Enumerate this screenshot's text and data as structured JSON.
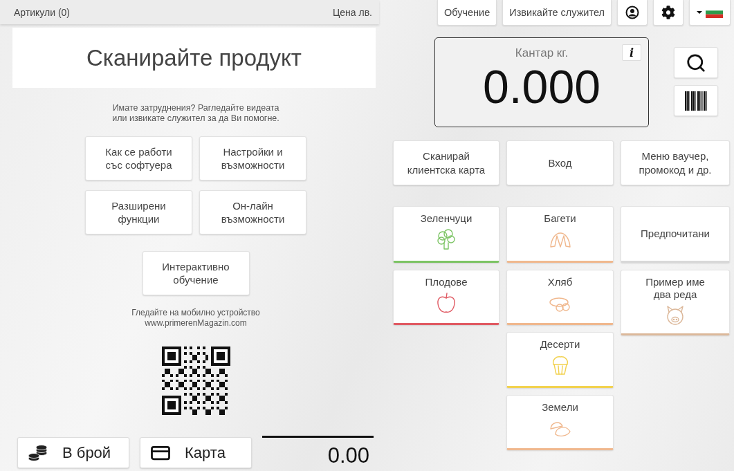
{
  "header": {
    "items_label": "Артикули (0)",
    "price_label": "Цена лв."
  },
  "top_buttons": [
    {
      "kind": "text",
      "label": "Обучение"
    },
    {
      "kind": "text",
      "label": "Извикайте служител"
    },
    {
      "kind": "user"
    },
    {
      "kind": "settings"
    },
    {
      "kind": "language"
    }
  ],
  "scan_prompt": "Сканирайте продукт",
  "help_text": "Имате затруднения? Рагледайте видеата\nили извикате служител за да Ви помогне.",
  "help_buttons": [
    {
      "label": "Как се работи\nсъс софтуера"
    },
    {
      "label": "Настройки и\nвъзможности"
    },
    {
      "label": "Разширени\nфункции"
    },
    {
      "label": "Он-лайн\nвъзможности"
    }
  ],
  "interactive_button": "Интерактивно\nобучение",
  "mobile_text": "Гледайте на мобилно устройство\nwww.primerenMagazin.com",
  "payment_buttons": [
    {
      "kind": "cash",
      "label": "В брой"
    },
    {
      "kind": "card",
      "label": "Карта"
    }
  ],
  "total": "0.00",
  "scale": {
    "label": "Кантар кг.",
    "value": "0.000",
    "info": "i"
  },
  "action_buttons": [
    {
      "label": "Сканирай\nклиентска карта"
    },
    {
      "label": "Вход"
    },
    {
      "label": "Меню ваучер,\nпромокод и др."
    }
  ],
  "category_columns": [
    [
      {
        "label": "Зеленчуци",
        "color": "#7cc464"
      },
      {
        "label": "Плодове",
        "color": "#e05a63"
      }
    ],
    [
      {
        "label": "Багети",
        "color": "#f0b88e"
      },
      {
        "label": "Хляб",
        "color": "#f0b88e"
      },
      {
        "label": "Десерти",
        "color": "#f2d250"
      },
      {
        "label": "Земели",
        "color": "#f0b88e"
      }
    ],
    [
      {
        "label": "Предпочитани",
        "color": "#d8d8d8"
      },
      {
        "label": "Пример име\nдва реда",
        "color": "#dcb89a"
      }
    ]
  ]
}
